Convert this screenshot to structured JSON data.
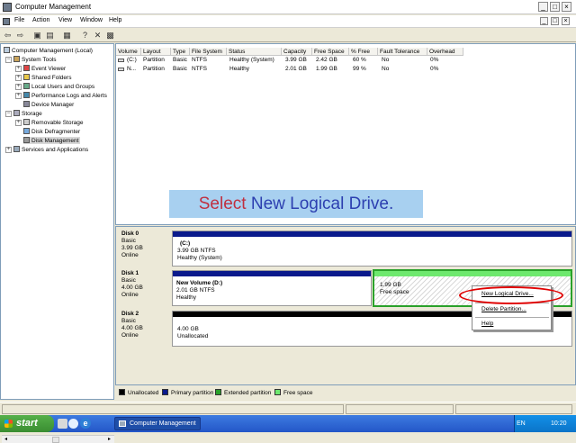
{
  "window": {
    "title": "Computer Management"
  },
  "menu": [
    "File",
    "Action",
    "View",
    "Window",
    "Help"
  ],
  "tree": [
    {
      "label": "Computer Management (Local)",
      "indent": 0
    },
    {
      "label": "System Tools",
      "indent": 1
    },
    {
      "label": "Event Viewer",
      "indent": 2
    },
    {
      "label": "Shared Folders",
      "indent": 2
    },
    {
      "label": "Local Users and Groups",
      "indent": 2
    },
    {
      "label": "Performance Logs and Alerts",
      "indent": 2
    },
    {
      "label": "Device Manager",
      "indent": 2
    },
    {
      "label": "Storage",
      "indent": 1
    },
    {
      "label": "Removable Storage",
      "indent": 2
    },
    {
      "label": "Disk Defragmenter",
      "indent": 2
    },
    {
      "label": "Disk Management",
      "indent": 2
    },
    {
      "label": "Services and Applications",
      "indent": 1
    }
  ],
  "volume_table": {
    "columns": [
      "Volume",
      "Layout",
      "Type",
      "File System",
      "Status",
      "Capacity",
      "Free Space",
      "% Free",
      "Fault Tolerance",
      "Overhead"
    ],
    "rows": [
      [
        "(C:)",
        "Partition",
        "Basic",
        "NTFS",
        "Healthy (System)",
        "3.99 GB",
        "2.42 GB",
        "60 %",
        "No",
        "0%"
      ],
      [
        "N...",
        "Partition",
        "Basic",
        "NTFS",
        "Healthy",
        "2.01 GB",
        "1.99 GB",
        "99 %",
        "No",
        "0%"
      ]
    ]
  },
  "banner": {
    "part1": "Select ",
    "part2": "New Logical Drive."
  },
  "disks": [
    {
      "name": "Disk 0",
      "type": "Basic",
      "size": "3.99 GB",
      "state": "Online",
      "part_title": "(C:)",
      "part_size": "3.99 GB NTFS",
      "part_status": "Healthy (System)"
    },
    {
      "name": "Disk 1",
      "type": "Basic",
      "size": "4.00 GB",
      "state": "Online",
      "part_title": "New Volume  (D:)",
      "part_size": "2.01 GB NTFS",
      "part_status": "Healthy",
      "free_size": "1.99 GB",
      "free_label": "Free space"
    },
    {
      "name": "Disk 2",
      "type": "Basic",
      "size": "4.00 GB",
      "state": "Online",
      "part_title": "",
      "part_size": "4.00 GB",
      "part_status": "Unallocated"
    }
  ],
  "context_menu": [
    "New Logical Drive...",
    "Delete Partition...",
    "Help"
  ],
  "legend": [
    {
      "label": "Unallocated",
      "color": "#000000"
    },
    {
      "label": "Primary partition",
      "color": "#0a1a8c"
    },
    {
      "label": "Extended partition",
      "color": "#2aa12a"
    },
    {
      "label": "Free space",
      "color": "#6ee86e"
    }
  ],
  "taskbar": {
    "start": "start",
    "task": "Computer Management",
    "lang": "EN",
    "clock": "10:20"
  },
  "colors": {
    "primary": "#0a1a8c",
    "extended": "#2aa12a",
    "free": "#6ee86e",
    "highlight": "#e00000"
  }
}
